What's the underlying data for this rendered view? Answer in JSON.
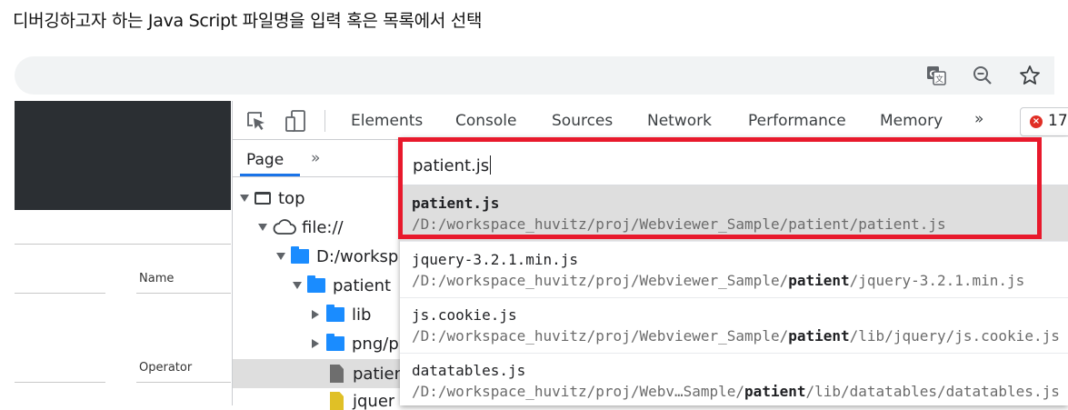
{
  "caption": "디버깅하고자 하는 Java Script 파일명을 입력 혹은 목록에서 선택",
  "browser": {
    "icons": [
      "translate-icon",
      "zoom-out-icon",
      "bookmark-star-icon"
    ]
  },
  "page": {
    "fields": [
      {
        "label": "Name"
      },
      {
        "label": "Operator"
      }
    ]
  },
  "devtools": {
    "tabs": [
      "Elements",
      "Console",
      "Sources",
      "Network",
      "Performance",
      "Memory"
    ],
    "more_tabs": "»",
    "error_count": "17",
    "navigator": {
      "tab": "Page",
      "more": "»",
      "tree": [
        {
          "label": "top",
          "type": "frame",
          "expanded": true
        },
        {
          "label": "file://",
          "type": "cloud",
          "expanded": true
        },
        {
          "label": "D:/worksp",
          "type": "folder",
          "expanded": true
        },
        {
          "label": "patient",
          "type": "folder",
          "expanded": true
        },
        {
          "label": "lib",
          "type": "folder",
          "expanded": false
        },
        {
          "label": "png/p",
          "type": "folder",
          "expanded": false
        },
        {
          "label": "patien",
          "type": "file",
          "selected": true
        },
        {
          "label": "jquer",
          "type": "file-js"
        }
      ]
    }
  },
  "quick_open": {
    "input_value": "patient.js",
    "results": [
      {
        "name": "patient.js",
        "path": "/D:/workspace_huvitz/proj/Webviewer_Sample/patient/patient.js",
        "selected": true
      },
      {
        "name": "jquery-3.2.1.min.js",
        "path_pre": "/D:/workspace_huvitz/proj/Webviewer_Sample/",
        "path_match": "patient",
        "path_post": "/jquery-3.2.1.min.js"
      },
      {
        "name": "js.cookie.js",
        "path_pre": "/D:/workspace_huvitz/proj/Webviewer_Sample/",
        "path_match": "patient",
        "path_post": "/lib/jquery/js.cookie.js"
      },
      {
        "name": "datatables.js",
        "path_pre": "/D:/workspace_huvitz/proj/Webv…Sample/",
        "path_match": "patient",
        "path_post": "/lib/datatables/datatables.js"
      }
    ]
  },
  "colors": {
    "highlight_box": "#e8192c",
    "selected_row": "#dedede",
    "folder": "#1a8cff",
    "dark_header": "#2b2f33"
  }
}
